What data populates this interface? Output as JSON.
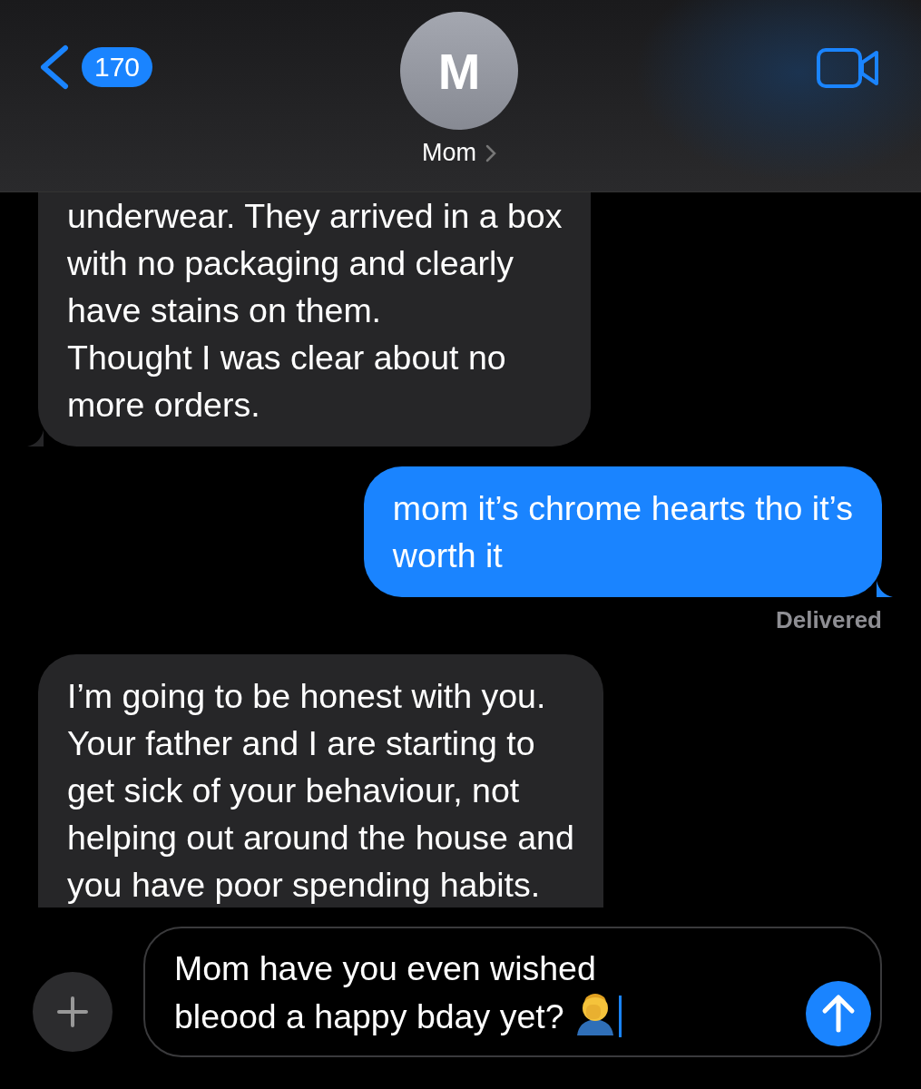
{
  "header": {
    "back_count": "170",
    "avatar_initial": "M",
    "contact_name": "Mom"
  },
  "messages": [
    {
      "kind": "received",
      "text": "underwear. They arrived in a box\nwith no packaging and clearly\nhave stains on them.\nThought I was clear about no\nmore orders."
    },
    {
      "kind": "sent",
      "text": "mom it’s chrome hearts tho it’s\nworth it",
      "status": "Delivered"
    },
    {
      "kind": "received",
      "text": "I’m going to be honest with you.\nYour father and I are starting to\nget sick of your behaviour, not\nhelping out around the house and\nyou have poor spending habits."
    }
  ],
  "composer": {
    "value": "Mom have you even wished\nbleood a happy bday yet?"
  }
}
